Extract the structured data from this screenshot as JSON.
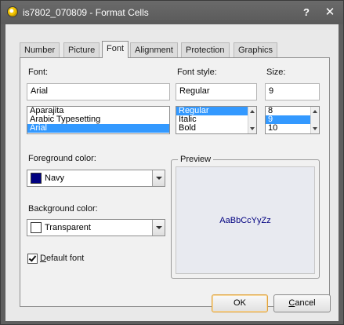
{
  "window": {
    "title": "is7802_070809 - Format Cells",
    "help_glyph": "?",
    "close_glyph": "✕"
  },
  "tabs": [
    {
      "label": "Number"
    },
    {
      "label": "Picture"
    },
    {
      "label": "Font"
    },
    {
      "label": "Alignment"
    },
    {
      "label": "Protection"
    },
    {
      "label": "Graphics"
    }
  ],
  "active_tab": "Font",
  "font": {
    "label": "Font:",
    "value": "Arial",
    "list": [
      "Aparajita",
      "Arabic Typesetting",
      "Arial"
    ],
    "selected": "Arial"
  },
  "font_style": {
    "label": "Font style:",
    "value": "Regular",
    "list": [
      "Regular",
      "Italic",
      "Bold"
    ],
    "selected": "Regular"
  },
  "size": {
    "label": "Size:",
    "value": "9",
    "list": [
      "8",
      "9",
      "10"
    ],
    "selected": "9"
  },
  "foreground": {
    "label": "Foreground color:",
    "value": "Navy",
    "swatch_color": "#000080"
  },
  "background": {
    "label": "Background color:",
    "value": "Transparent",
    "swatch_color": "#ffffff"
  },
  "preview": {
    "title": "Preview",
    "sample": "AaBbCcYyZz",
    "text_color": "#000080"
  },
  "default_font": {
    "label_hotkey": "D",
    "label_rest": "efault font",
    "checked": true
  },
  "buttons": {
    "ok": "OK",
    "cancel_hotkey": "C",
    "cancel_rest": "ancel"
  }
}
